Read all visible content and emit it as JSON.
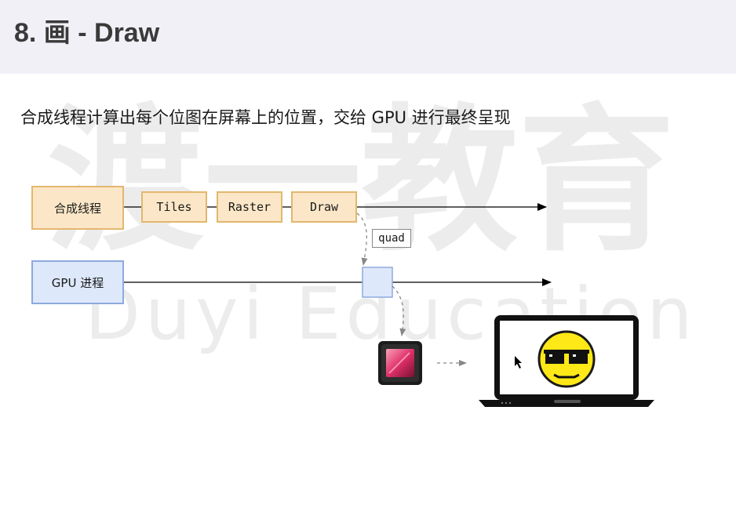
{
  "header": {
    "title": "8. 画 - Draw"
  },
  "subtitle": "合成线程计算出每个位图在屏幕上的位置，交给 GPU 进行最终呈现",
  "watermark": {
    "line1": "渡一教育",
    "line2": "Duyi Education"
  },
  "diagram": {
    "compositor_thread": "合成线程",
    "tiles": "Tiles",
    "raster": "Raster",
    "draw": "Draw",
    "quad": "quad",
    "gpu_process": "GPU 进程"
  },
  "colors": {
    "orange_fill": "#fbe7c7",
    "orange_border": "#e2b76f",
    "blue_fill": "#dde8fb",
    "blue_border": "#8eaadd"
  },
  "icons": {
    "chip": "gpu-chip-icon",
    "laptop": "laptop-icon",
    "face": "sunglasses-smiley-icon",
    "cursor": "mouse-cursor-icon"
  }
}
